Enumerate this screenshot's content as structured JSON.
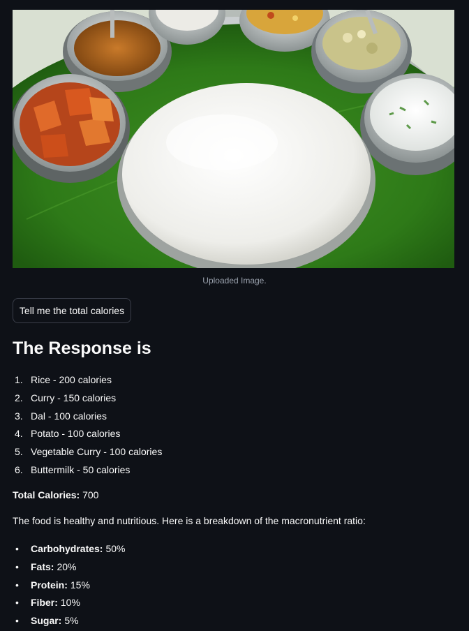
{
  "image": {
    "caption": "Uploaded Image.",
    "subject": "food-plate-photo"
  },
  "button": {
    "label": "Tell me the total calories"
  },
  "response": {
    "heading": "The Response is",
    "items": [
      {
        "num": "1.",
        "text": "Rice - 200 calories"
      },
      {
        "num": "2.",
        "text": "Curry - 150 calories"
      },
      {
        "num": "3.",
        "text": "Dal - 100 calories"
      },
      {
        "num": "4.",
        "text": "Potato - 100 calories"
      },
      {
        "num": "5.",
        "text": "Vegetable Curry - 100 calories"
      },
      {
        "num": "6.",
        "text": "Buttermilk - 50 calories"
      }
    ],
    "total_label": "Total Calories:",
    "total_value": "700",
    "summary": "The food is healthy and nutritious. Here is a breakdown of the macronutrient ratio:",
    "macros": [
      {
        "label": "Carbohydrates:",
        "value": "50%"
      },
      {
        "label": "Fats:",
        "value": "20%"
      },
      {
        "label": "Protein:",
        "value": "15%"
      },
      {
        "label": "Fiber:",
        "value": "10%"
      },
      {
        "label": "Sugar:",
        "value": "5%"
      }
    ]
  },
  "colors": {
    "background": "#0e1117",
    "text": "#fafafa",
    "caption": "#9ca3af",
    "button_border": "#3b3f4a"
  }
}
